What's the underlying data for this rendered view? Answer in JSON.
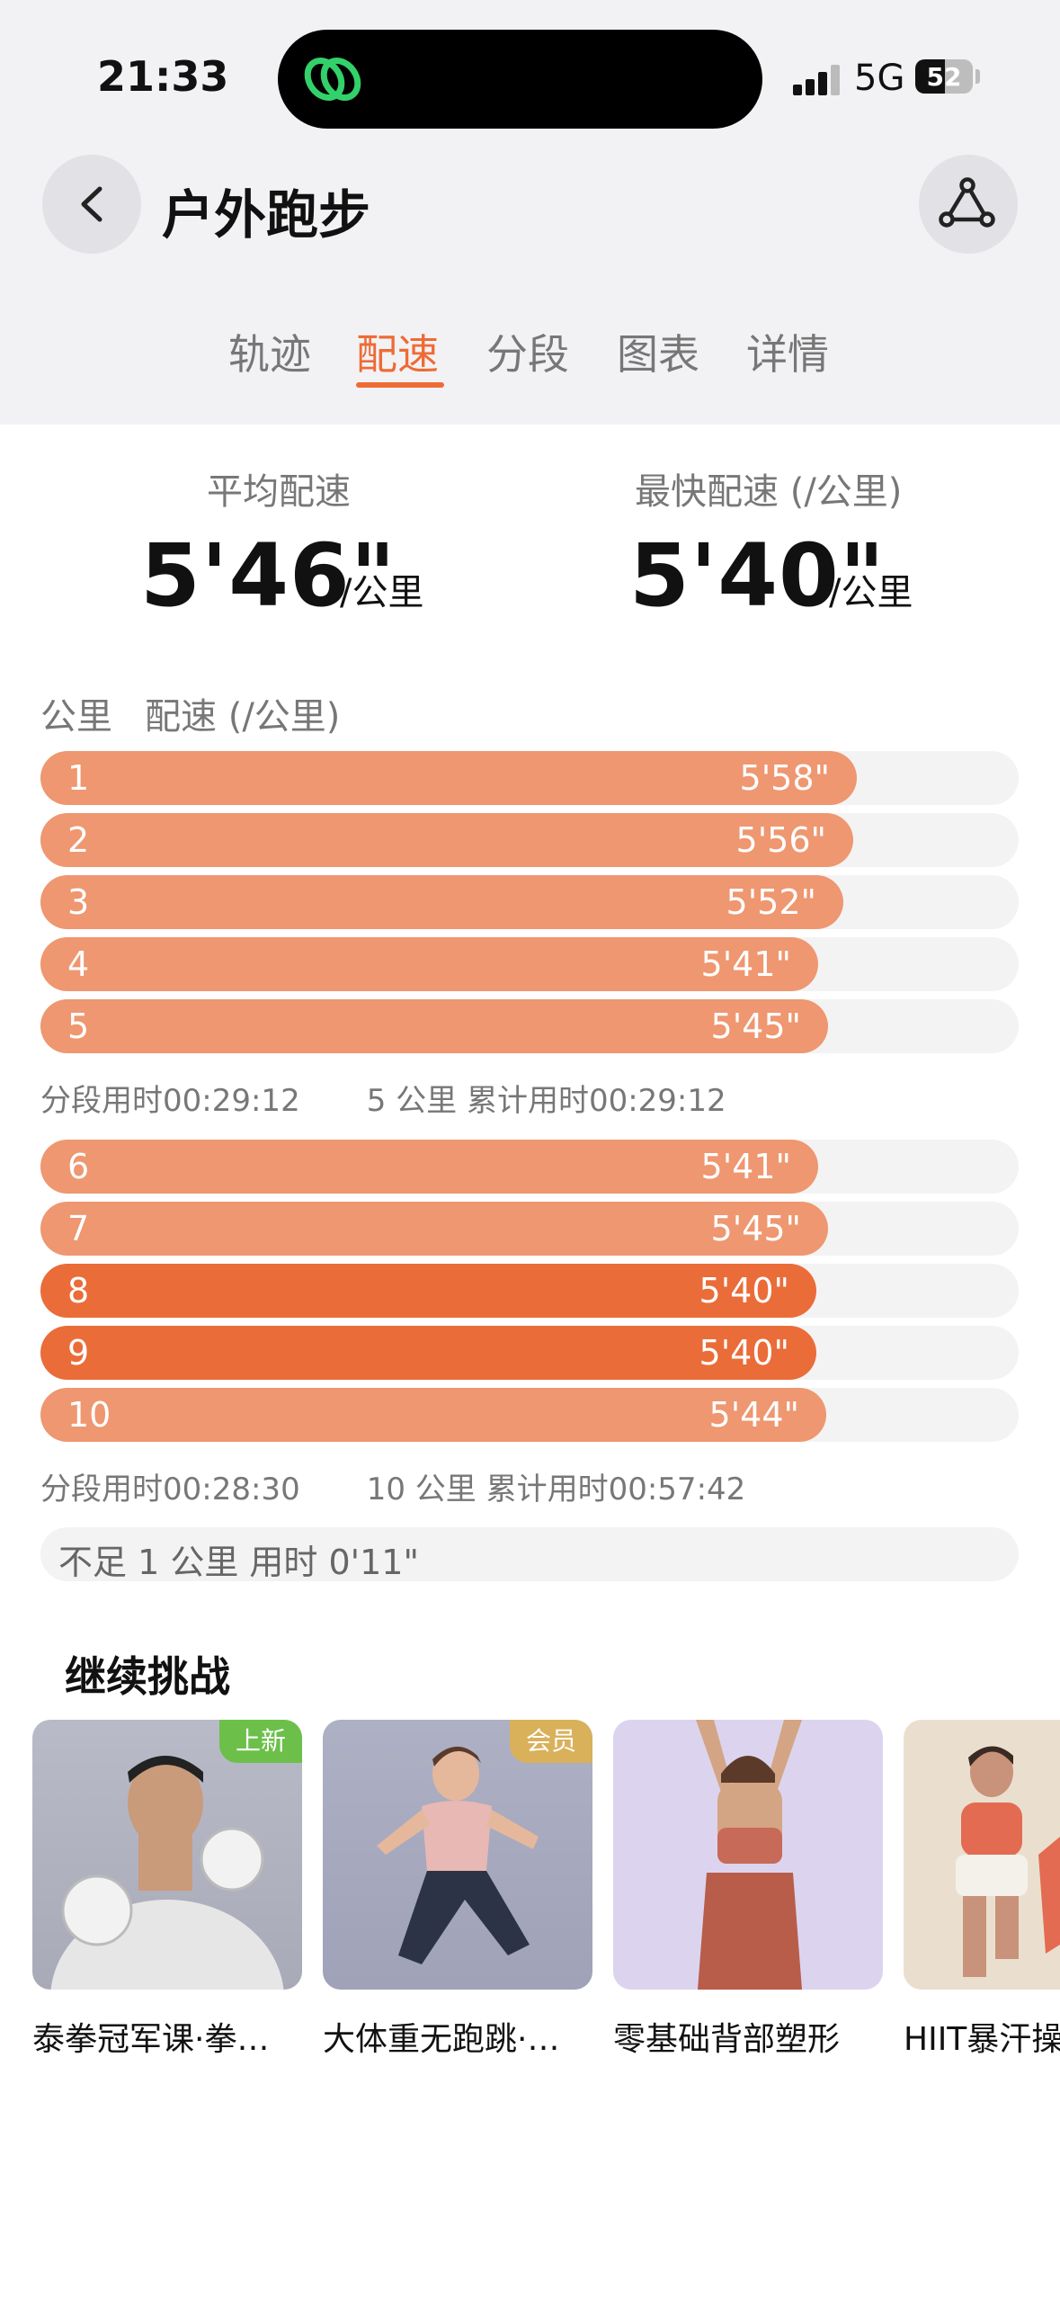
{
  "status_bar": {
    "time": "21:33",
    "network": "5G",
    "battery": "52",
    "battery_level": 0.52
  },
  "header": {
    "title": "户外跑步"
  },
  "tabs": [
    {
      "label": "轨迹"
    },
    {
      "label": "配速"
    },
    {
      "label": "分段"
    },
    {
      "label": "图表"
    },
    {
      "label": "详情"
    }
  ],
  "stats": {
    "avg_label": "平均配速",
    "avg_value": "5'46\"",
    "fast_label": "最快配速 (/公里)",
    "fast_value": "5'40\"",
    "unit": "/公里"
  },
  "table": {
    "col_km": "公里",
    "col_pace": "配速 (/公里)"
  },
  "splits": [
    {
      "km": "1",
      "pace": "5'58\"",
      "fraction": 0.835
    },
    {
      "km": "2",
      "pace": "5'56\"",
      "fraction": 0.831
    },
    {
      "km": "3",
      "pace": "5'52\"",
      "fraction": 0.821
    },
    {
      "km": "4",
      "pace": "5'41\"",
      "fraction": 0.795
    },
    {
      "km": "5",
      "pace": "5'45\"",
      "fraction": 0.805
    },
    {
      "km": "6",
      "pace": "5'41\"",
      "fraction": 0.795
    },
    {
      "km": "7",
      "pace": "5'45\"",
      "fraction": 0.805
    },
    {
      "km": "8",
      "pace": "5'40\"",
      "fraction": 0.793,
      "fastest": true
    },
    {
      "km": "9",
      "pace": "5'40\"",
      "fraction": 0.793,
      "fastest": true
    },
    {
      "km": "10",
      "pace": "5'44\"",
      "fraction": 0.803
    }
  ],
  "summaries": [
    {
      "segment": "分段用时00:29:12",
      "cumulative": "5 公里 累计用时00:29:12"
    },
    {
      "segment": "分段用时00:28:30",
      "cumulative": "10 公里 累计用时00:57:42"
    }
  ],
  "remainder": "不足 1 公里 用时 0'11\"",
  "challenge": {
    "title": "继续挑战",
    "cards": [
      {
        "label": "泰拳冠军课·拳…",
        "badge": "上新",
        "badge_color": "#6cc04a"
      },
      {
        "label": "大体重无跑跳·…",
        "badge": "会员",
        "badge_color": "#d9b15b"
      },
      {
        "label": "零基础背部塑形",
        "badge": ""
      },
      {
        "label": "HIIT暴汗操",
        "badge": ""
      }
    ]
  },
  "colors": {
    "accent": "#ee6b35",
    "bar": "#ee9770",
    "bar_fastest": "#ea6c38"
  }
}
